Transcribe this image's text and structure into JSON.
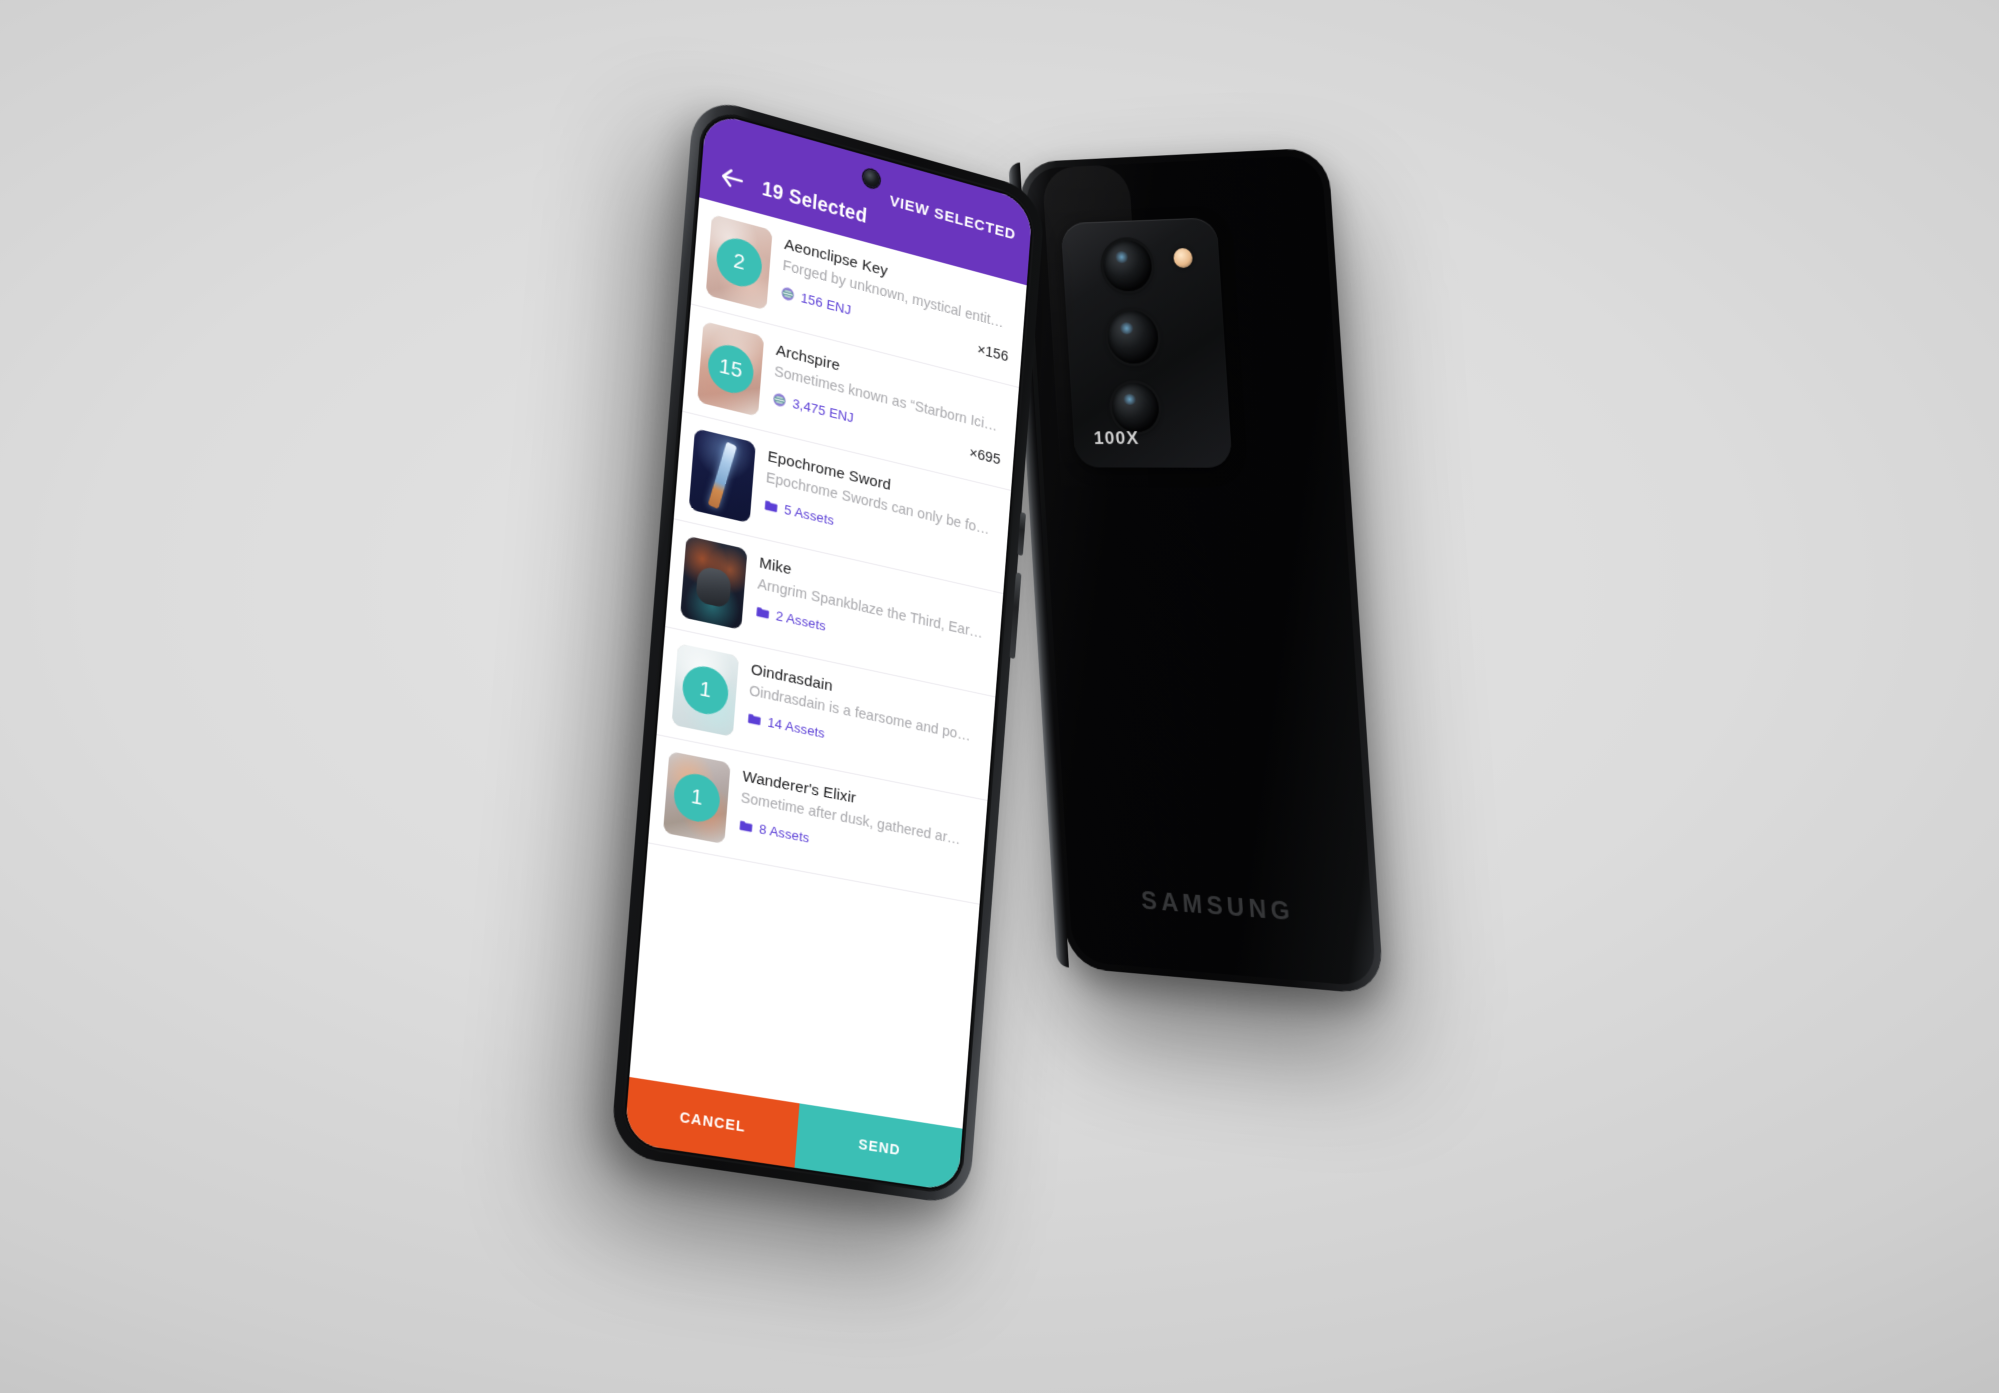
{
  "app": {
    "header": {
      "back_icon": "back-arrow-icon",
      "title": "19 Selected",
      "action_label": "VIEW SELECTED",
      "background_color": "#6A35BE"
    },
    "list": [
      {
        "title": "Aeonclipse Key",
        "description": "Forged by unknown, mystical entit…",
        "badge": "2",
        "meta_icon": "enj-coin-icon",
        "meta_text": "156 ENJ",
        "count": "×156",
        "art": "art-key"
      },
      {
        "title": "Archspire",
        "description": "Sometimes known as “Starborn Ici…",
        "badge": "15",
        "meta_icon": "enj-coin-icon",
        "meta_text": "3,475 ENJ",
        "count": "×695",
        "art": "art-spire"
      },
      {
        "title": "Epochrome Sword",
        "description": "Epochrome Swords can only be fo…",
        "badge": "",
        "meta_icon": "folder-icon",
        "meta_text": "5 Assets",
        "count": "",
        "art": "art-sword"
      },
      {
        "title": "Mike",
        "description": "Arngrim Spankblaze the Third, Ear…",
        "badge": "",
        "meta_icon": "folder-icon",
        "meta_text": "2 Assets",
        "count": "",
        "art": "art-mike"
      },
      {
        "title": "Oindrasdain",
        "description": "Oindrasdain is a fearsome and po…",
        "badge": "1",
        "meta_icon": "folder-icon",
        "meta_text": "14 Assets",
        "count": "",
        "art": "art-oin"
      },
      {
        "title": "Wanderer's Elixir",
        "description": "Sometime after dusk, gathered ar…",
        "badge": "1",
        "meta_icon": "folder-icon",
        "meta_text": "8 Assets",
        "count": "",
        "art": "art-elixir"
      }
    ],
    "actions": {
      "cancel_label": "CANCEL",
      "cancel_color": "#E8501C",
      "send_label": "SEND",
      "send_color": "#3BBFB5"
    },
    "theme": {
      "badge_color": "#3BBFB5",
      "link_color": "#5B3FD6",
      "title_color": "#1B1B1D",
      "description_color": "#A9A9AD"
    }
  },
  "device_back": {
    "camera_label": "100X",
    "brand": "SAMSUNG"
  }
}
